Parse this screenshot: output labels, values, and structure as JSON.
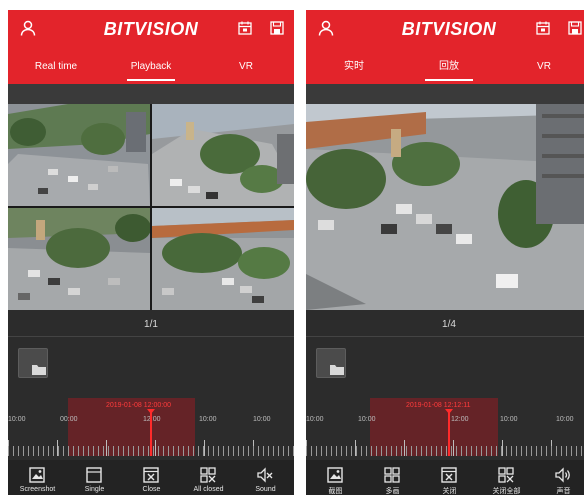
{
  "colors": {
    "accent_red": "#e3242b",
    "dark_bg": "#2c2c2c",
    "toolbar_bg": "#232323",
    "timeline_highlight": "#961e24"
  },
  "left": {
    "header": {
      "title": "BITVISION",
      "icons": [
        "user-icon",
        "calendar-icon",
        "save-icon"
      ]
    },
    "tabs": [
      {
        "label": "Real time",
        "active": false
      },
      {
        "label": "Playback",
        "active": true
      },
      {
        "label": "VR",
        "active": false
      }
    ],
    "video": {
      "layout": "2x2 grid of camera feeds"
    },
    "pager": "1/1",
    "timeline": {
      "timestamp": "2019-01-08 12:00:00",
      "hours": [
        "10:00",
        "00:00",
        "12:00",
        "10:00",
        "10:00"
      ]
    },
    "toolbar": [
      {
        "label": "Screenshot",
        "icon": "screenshot-icon"
      },
      {
        "label": "Single",
        "icon": "single-window-icon"
      },
      {
        "label": "Close",
        "icon": "close-window-icon"
      },
      {
        "label": "All closed",
        "icon": "all-closed-icon"
      },
      {
        "label": "Sound",
        "icon": "sound-muted-icon"
      }
    ]
  },
  "right": {
    "header": {
      "title": "BITVISION",
      "icons": [
        "user-icon",
        "calendar-icon",
        "save-icon"
      ]
    },
    "tabs": [
      {
        "label": "实时",
        "active": false
      },
      {
        "label": "回放",
        "active": true
      },
      {
        "label": "VR",
        "active": false
      }
    ],
    "video": {
      "layout": "single camera feed"
    },
    "pager": "1/4",
    "timeline": {
      "timestamp": "2019-01-08 12:12:11",
      "hours": [
        "10:00",
        "10:00",
        "12:00",
        "10:00",
        "10:00"
      ]
    },
    "toolbar": [
      {
        "label": "截图",
        "icon": "screenshot-icon"
      },
      {
        "label": "多画",
        "icon": "multi-window-icon"
      },
      {
        "label": "关闭",
        "icon": "close-window-icon"
      },
      {
        "label": "关闭全部",
        "icon": "all-closed-icon"
      },
      {
        "label": "声音",
        "icon": "sound-on-icon"
      }
    ]
  }
}
